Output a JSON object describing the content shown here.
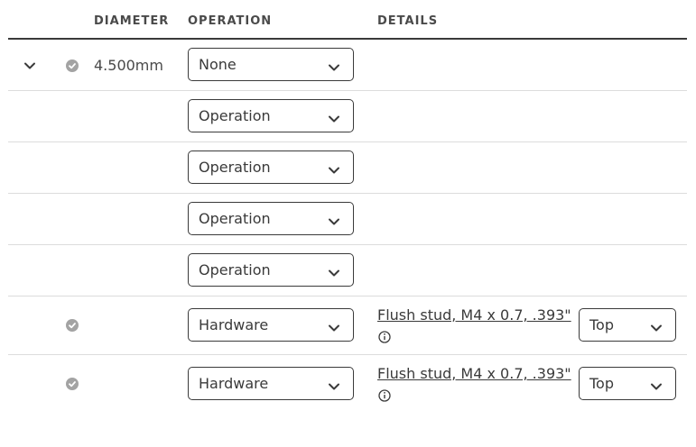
{
  "headers": {
    "diameter": "DIAMETER",
    "operation": "OPERATION",
    "details": "DETAILS"
  },
  "rows": [
    {
      "diameter": "4.500mm",
      "operation": "None",
      "checked": true,
      "expandable": true
    },
    {
      "operation": "Operation"
    },
    {
      "operation": "Operation"
    },
    {
      "operation": "Operation"
    },
    {
      "operation": "Operation"
    },
    {
      "operation": "Hardware",
      "checked": true,
      "detail_link": "Flush stud, M4 x 0.7, .393\"",
      "position": "Top"
    },
    {
      "operation": "Hardware",
      "checked": true,
      "detail_link": "Flush stud, M4 x 0.7, .393\"",
      "position": "Top"
    }
  ],
  "icons": {
    "expand": "chevron-down-icon",
    "status": "check-circle-icon",
    "dropdown": "chevron-down-icon",
    "info": "info-icon"
  },
  "colors": {
    "text": "#3a3a3a",
    "check": "#a3a3a3",
    "divider": "#dcdcdc"
  }
}
